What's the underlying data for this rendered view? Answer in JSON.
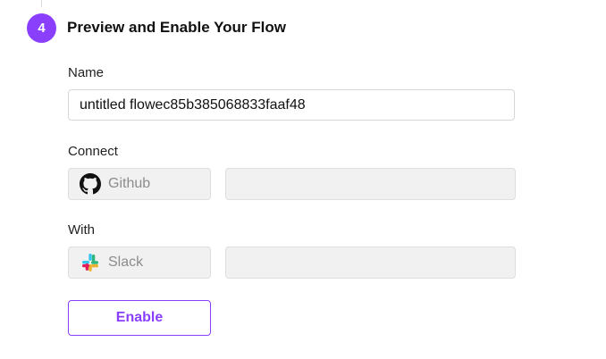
{
  "step": {
    "number": "4",
    "title": "Preview and Enable Your Flow"
  },
  "name_field": {
    "label": "Name",
    "value": "untitled flowec85b385068833faaf48"
  },
  "connect": {
    "label": "Connect",
    "app_name": "Github",
    "app_icon": "github-icon",
    "select_value": ""
  },
  "with": {
    "label": "With",
    "app_name": "Slack",
    "app_icon": "slack-icon",
    "select_value": ""
  },
  "enable_button": {
    "label": "Enable"
  },
  "colors": {
    "accent": "#8a3ffc",
    "disabled_bg": "#f1f1f1",
    "disabled_text": "#8c8c8c"
  }
}
